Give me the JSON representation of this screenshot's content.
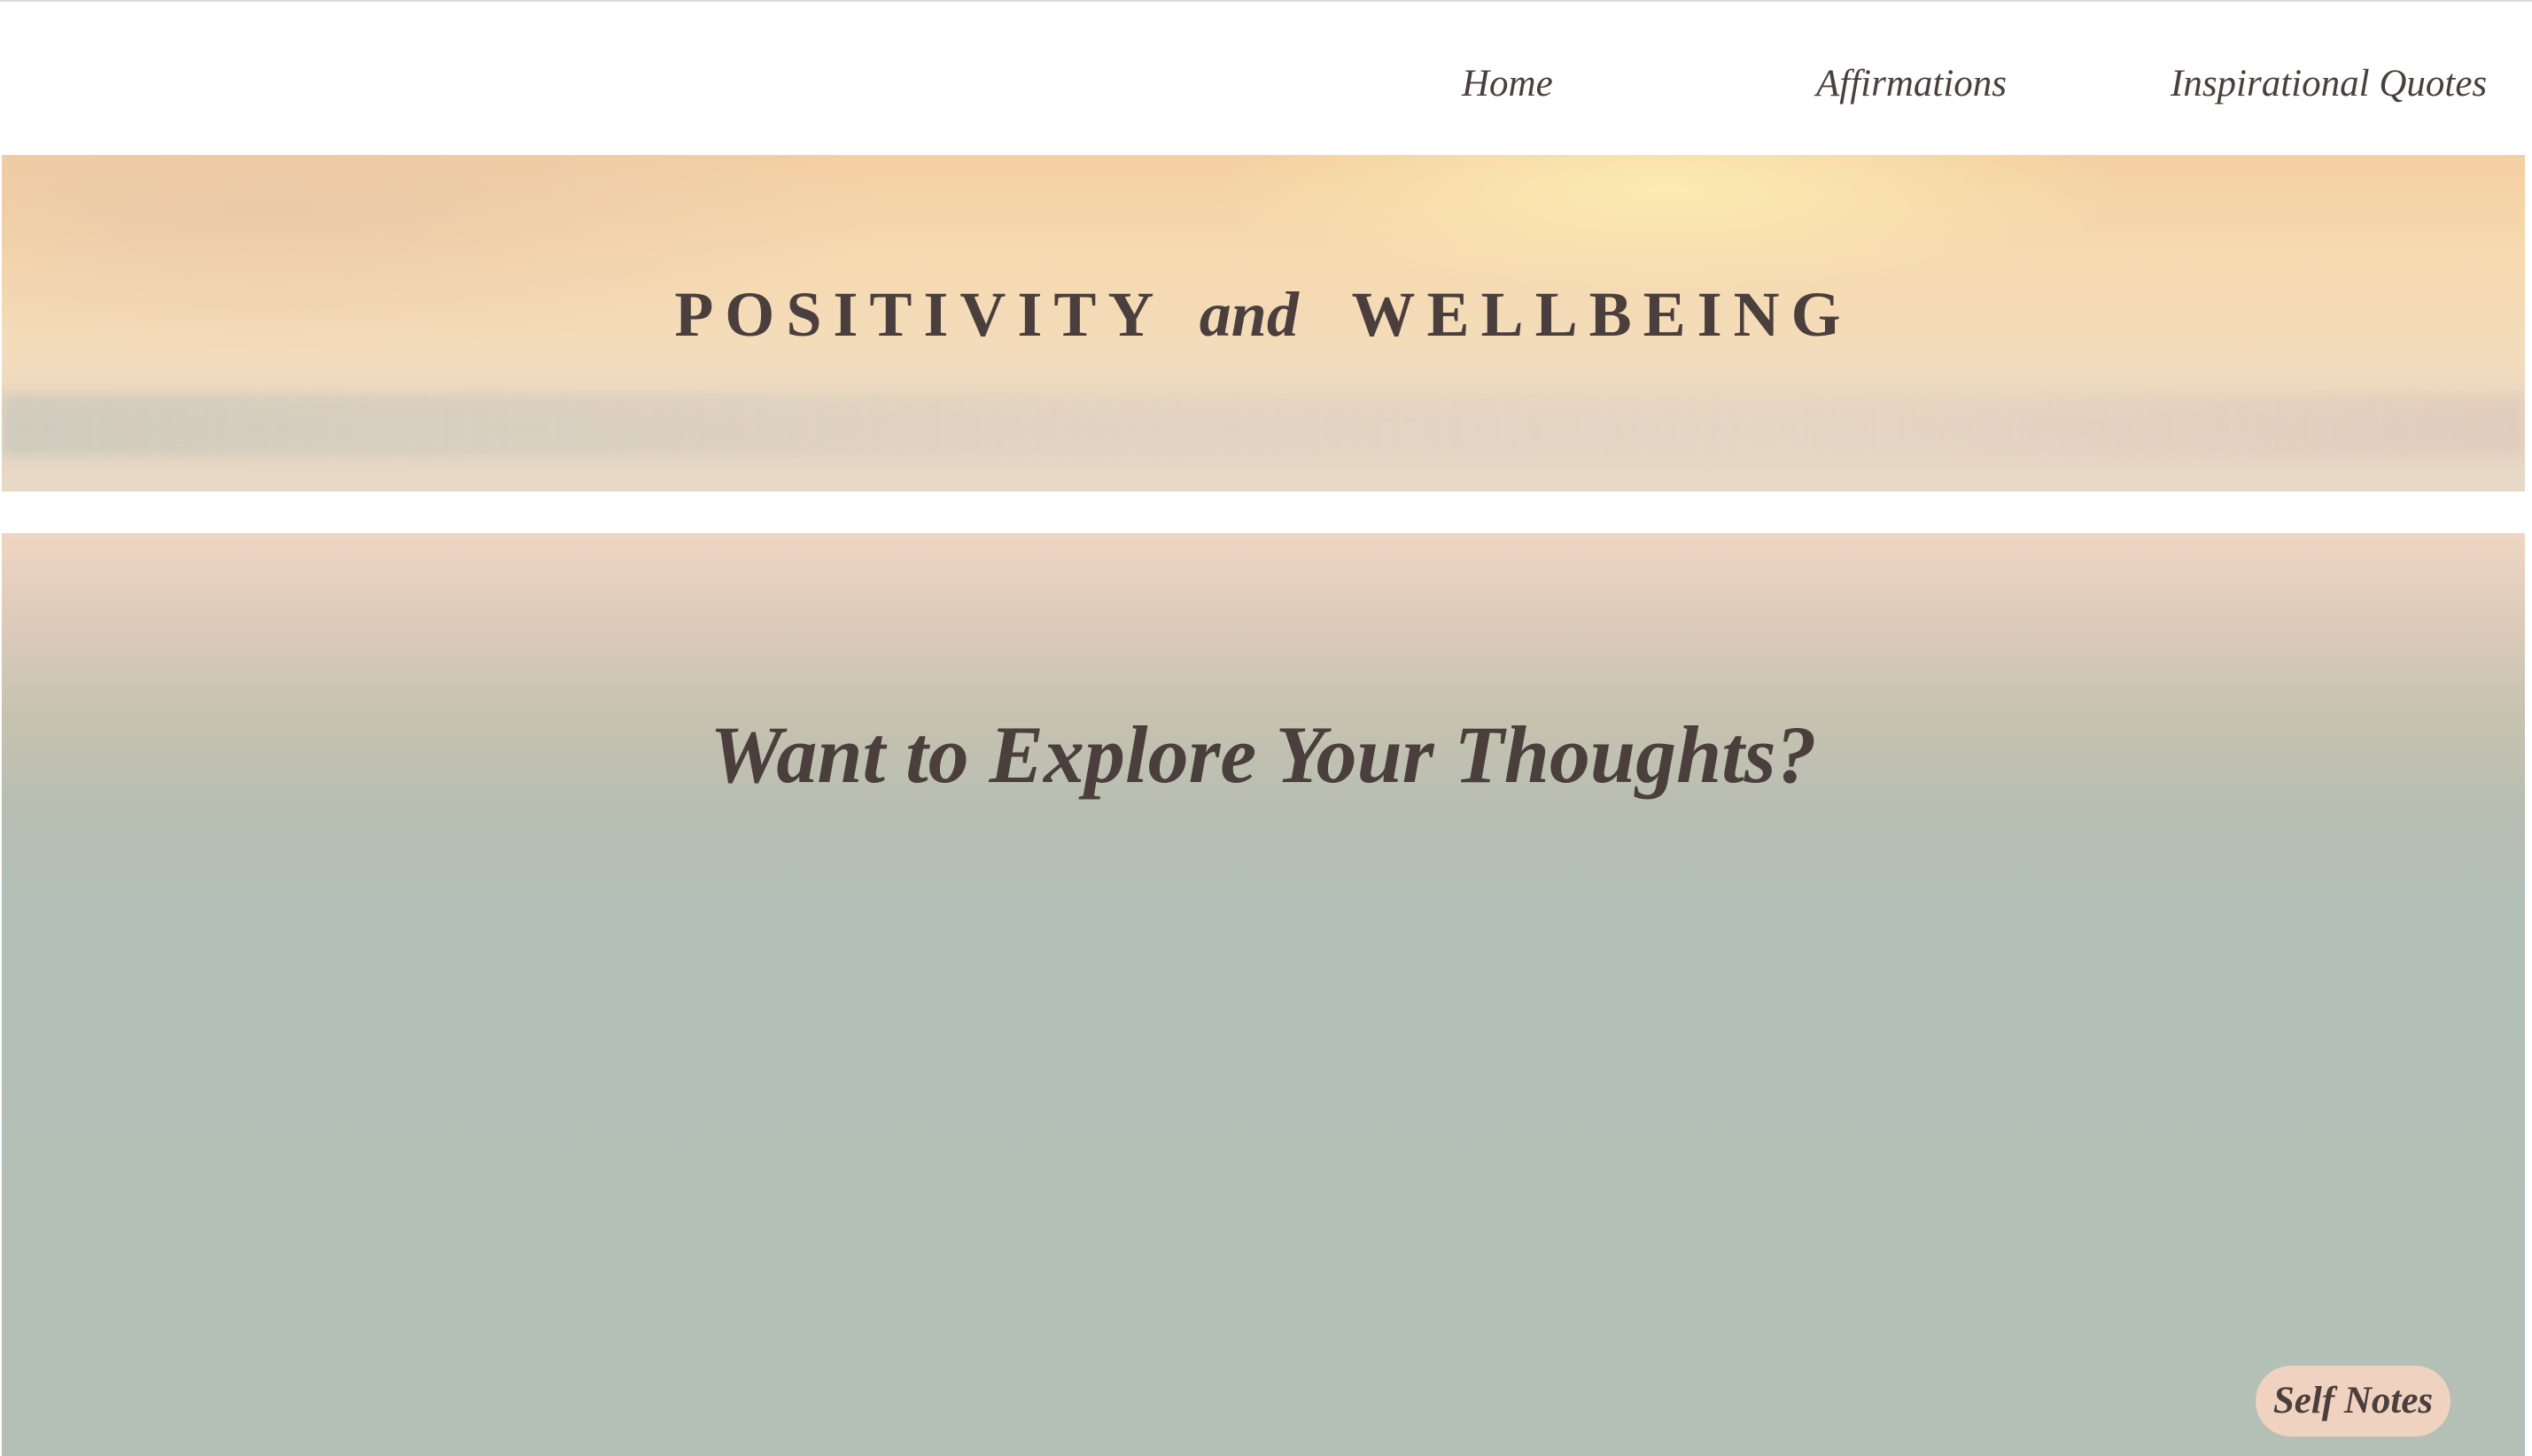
{
  "nav": {
    "items": [
      {
        "label": "Home"
      },
      {
        "label": "Affirmations"
      },
      {
        "label": "Inspirational Quotes"
      }
    ]
  },
  "hero": {
    "title_part1": "POSITIVITY",
    "title_connector": "and",
    "title_part2": "WELLBEING"
  },
  "main": {
    "heading": "Want to Explore Your Thoughts?"
  },
  "floating_button": {
    "label": "Self Notes"
  },
  "colors": {
    "text": "#4a3f3d",
    "button_bg": "#efd3c0",
    "section_bg": "#b4bfb6"
  }
}
